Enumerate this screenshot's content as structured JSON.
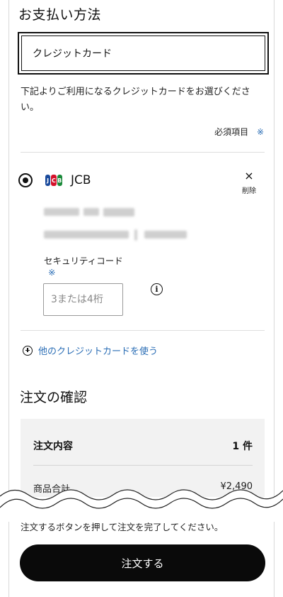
{
  "payment": {
    "title": "お支払い方法",
    "selected_method": "クレジットカード",
    "description": "下記よりご利用になるクレジットカードをお選びください。",
    "required_label": "必須項目",
    "required_mark": "※"
  },
  "card": {
    "brand": "JCB",
    "brand_logo": "jcb-logo-icon",
    "selected": true,
    "delete_icon": "×",
    "delete_label": "削除",
    "security_label": "セキュリティコード",
    "security_required_mark": "※",
    "security_placeholder": "3または4桁",
    "info_icon": "i"
  },
  "other_card": {
    "label": "他のクレジットカードを使う"
  },
  "order": {
    "title": "注文の確認",
    "contents_label": "注文内容",
    "contents_count": "1 件",
    "subtotal_label": "商品合計",
    "subtotal_value": "¥2,490"
  },
  "footer": {
    "notice": "注文するボタンを押して注文を完了してください。",
    "submit_label": "注文する"
  },
  "colors": {
    "accent_link": "#2a6db5",
    "button_bg": "#0a0a0a"
  }
}
